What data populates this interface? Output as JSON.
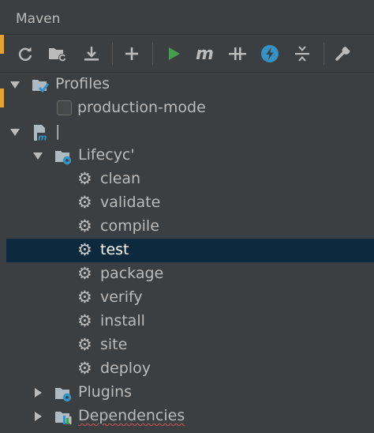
{
  "panel": {
    "title": "Maven"
  },
  "toolbar": {
    "buttons": [
      {
        "icon": "reload-icon"
      },
      {
        "icon": "generate-sources-icon"
      },
      {
        "icon": "download-icon"
      },
      {
        "icon": "add-icon"
      },
      {
        "icon": "run-icon"
      },
      {
        "icon": "maven-goal-icon"
      },
      {
        "icon": "skip-tests-icon"
      },
      {
        "icon": "offline-icon"
      },
      {
        "icon": "collapse-all-icon"
      },
      {
        "icon": "settings-wrench-icon"
      }
    ]
  },
  "tree": {
    "profiles": {
      "label": "Profiles",
      "items": [
        {
          "label": "production-mode",
          "checked": false
        }
      ]
    },
    "project": {
      "label": "|"
    },
    "lifecycle": {
      "label": "Lifecyc'",
      "goals": [
        "clean",
        "validate",
        "compile",
        "test",
        "package",
        "verify",
        "install",
        "site",
        "deploy"
      ],
      "selected": "test"
    },
    "plugins": {
      "label": "Plugins"
    },
    "dependencies": {
      "label": "Dependencies"
    }
  },
  "colors": {
    "background": "#3c3f41",
    "selection": "#0d293e",
    "text": "#bbbbbb",
    "run_green": "#499c54",
    "accent_blue": "#3592c4",
    "left_accent": "#e6a32e"
  }
}
